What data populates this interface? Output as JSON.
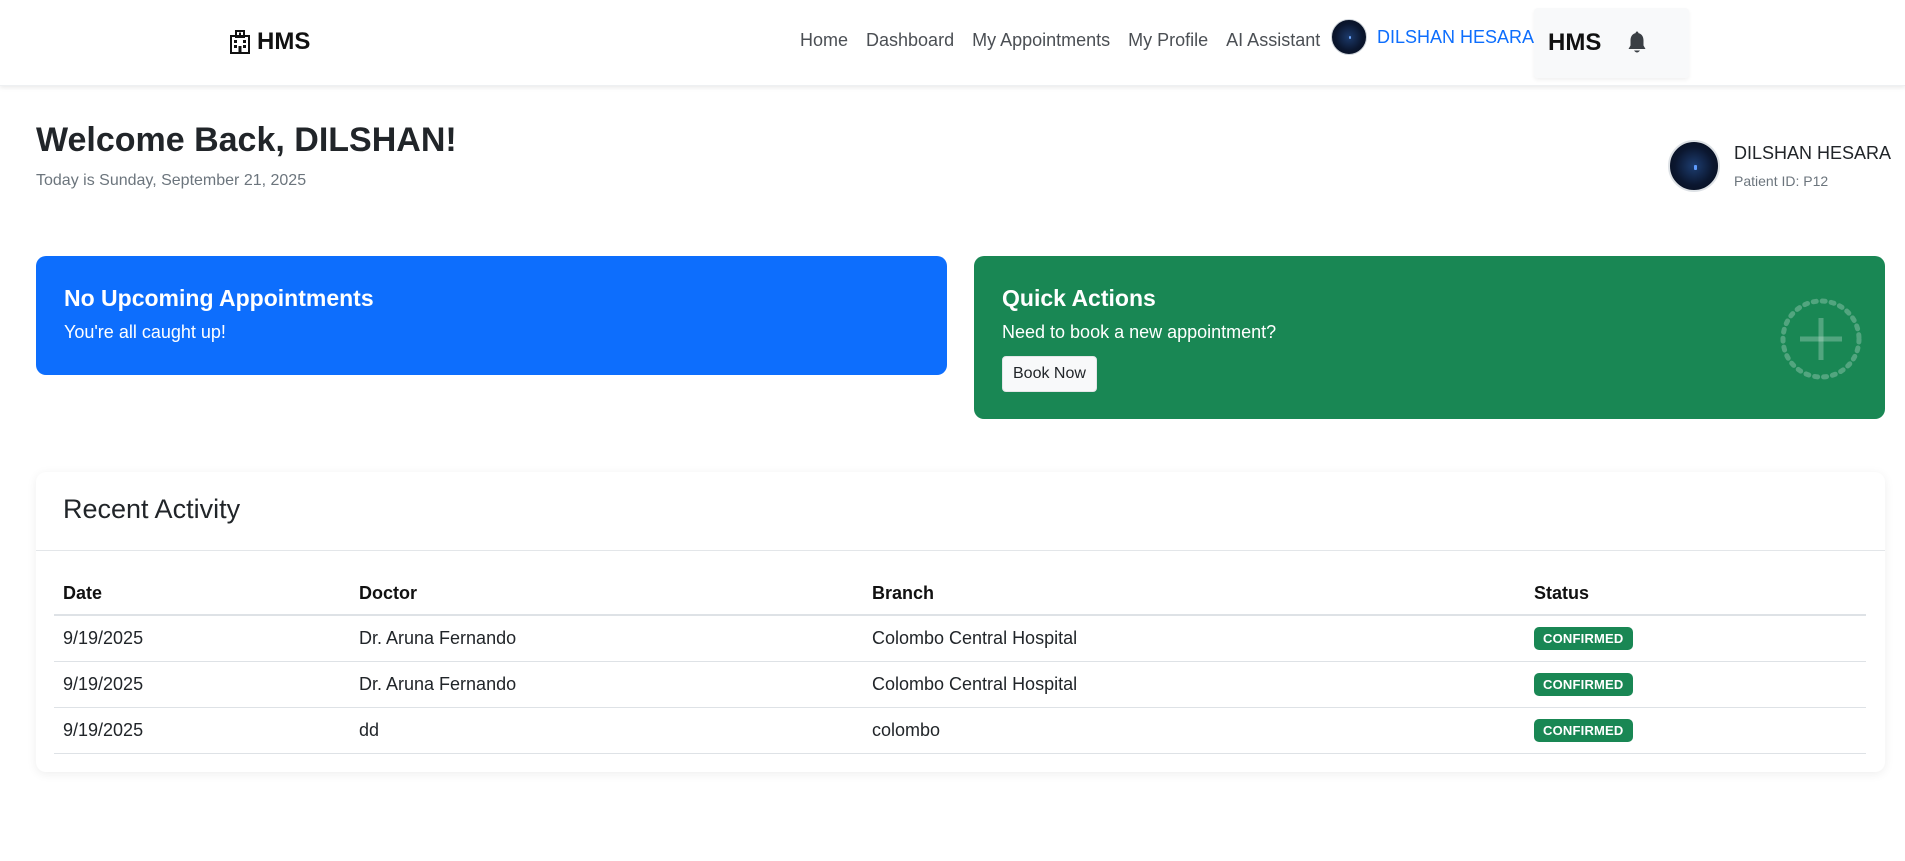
{
  "navbar": {
    "brand": "HMS",
    "links": [
      "Home",
      "Dashboard",
      "My Appointments",
      "My Profile",
      "AI Assistant"
    ],
    "user_name": "DILSHAN HESARA",
    "side_title": "HMS"
  },
  "header": {
    "welcome": "Welcome Back, DILSHAN!",
    "today": "Today is Sunday, September 21, 2025",
    "profile_name": "DILSHAN HESARA",
    "patient_id": "Patient ID: P12"
  },
  "cards": {
    "upcoming": {
      "title": "No Upcoming Appointments",
      "text": "You're all caught up!"
    },
    "quick": {
      "title": "Quick Actions",
      "text": "Need to book a new appointment?",
      "button": "Book Now"
    }
  },
  "activity": {
    "title": "Recent Activity",
    "columns": [
      "Date",
      "Doctor",
      "Branch",
      "Status"
    ],
    "rows": [
      {
        "date": "9/19/2025",
        "doctor": "Dr. Aruna Fernando",
        "branch": "Colombo Central Hospital",
        "status": "CONFIRMED"
      },
      {
        "date": "9/19/2025",
        "doctor": "Dr. Aruna Fernando",
        "branch": "Colombo Central Hospital",
        "status": "CONFIRMED"
      },
      {
        "date": "9/19/2025",
        "doctor": "dd",
        "branch": "colombo",
        "status": "CONFIRMED"
      }
    ]
  },
  "colors": {
    "primary": "#0d6efd",
    "success": "#198754",
    "text": "#212529",
    "muted": "#6c757d"
  },
  "icons": {
    "brand": "hospital-icon",
    "bell": "bell-icon",
    "quick_action": "plus-circle-icon",
    "dropdown": "caret-down-icon"
  }
}
